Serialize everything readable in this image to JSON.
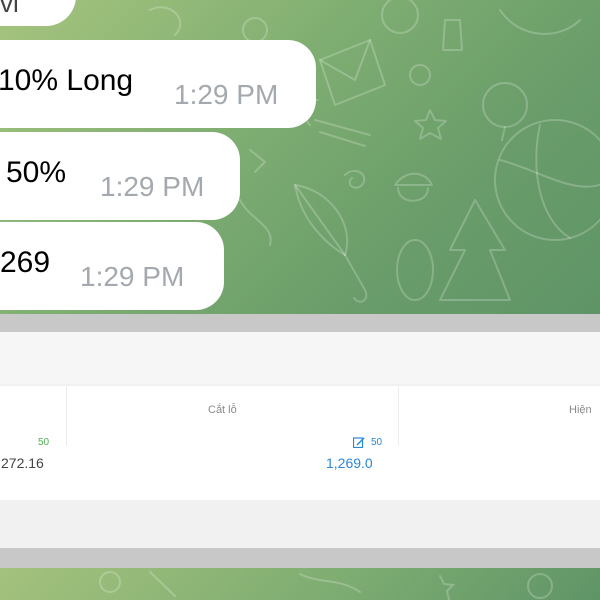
{
  "chat": {
    "messages": [
      {
        "text": "vi",
        "time": ""
      },
      {
        "text": "10% Long",
        "time": "1:29 PM"
      },
      {
        "text": "50%",
        "time": "1:29 PM"
      },
      {
        "text": "269",
        "time": "1:29 PM"
      }
    ],
    "background_color": "#7fae72"
  },
  "table": {
    "columns": [
      "",
      "Cắt lỗ",
      "Hiện"
    ],
    "row": {
      "col1_small": "50",
      "col1_value": "272.16",
      "col2_small": "50",
      "col2_value": "1,269.0"
    }
  },
  "colors": {
    "green_small": "#4caf50",
    "blue_link": "#2a88d8",
    "time_gray": "#a3a9ae"
  },
  "icons": [
    "edit-icon"
  ]
}
